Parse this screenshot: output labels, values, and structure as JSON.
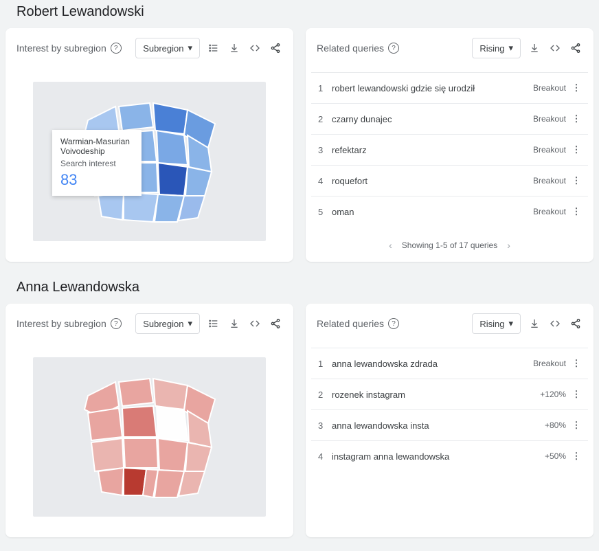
{
  "sections": [
    {
      "title": "Robert Lewandowski",
      "map": {
        "header": "Interest by subregion",
        "dropdown": "Subregion",
        "tooltip": {
          "region": "Warmian-Masurian Voivodeship",
          "label": "Search interest",
          "value": "83"
        },
        "color": "blue"
      },
      "queries": {
        "header": "Related queries",
        "dropdown": "Rising",
        "items": [
          {
            "rank": "1",
            "text": "robert lewandowski gdzie się urodził",
            "value": "Breakout"
          },
          {
            "rank": "2",
            "text": "czarny dunajec",
            "value": "Breakout"
          },
          {
            "rank": "3",
            "text": "refektarz",
            "value": "Breakout"
          },
          {
            "rank": "4",
            "text": "roquefort",
            "value": "Breakout"
          },
          {
            "rank": "5",
            "text": "oman",
            "value": "Breakout"
          }
        ],
        "pager": "Showing 1-5 of 17 queries"
      }
    },
    {
      "title": "Anna Lewandowska",
      "map": {
        "header": "Interest by subregion",
        "dropdown": "Subregion",
        "color": "red"
      },
      "queries": {
        "header": "Related queries",
        "dropdown": "Rising",
        "items": [
          {
            "rank": "1",
            "text": "anna lewandowska zdrada",
            "value": "Breakout"
          },
          {
            "rank": "2",
            "text": "rozenek instagram",
            "value": "+120%"
          },
          {
            "rank": "3",
            "text": "anna lewandowska insta",
            "value": "+80%"
          },
          {
            "rank": "4",
            "text": "instagram anna lewandowska",
            "value": "+50%"
          }
        ]
      }
    }
  ]
}
